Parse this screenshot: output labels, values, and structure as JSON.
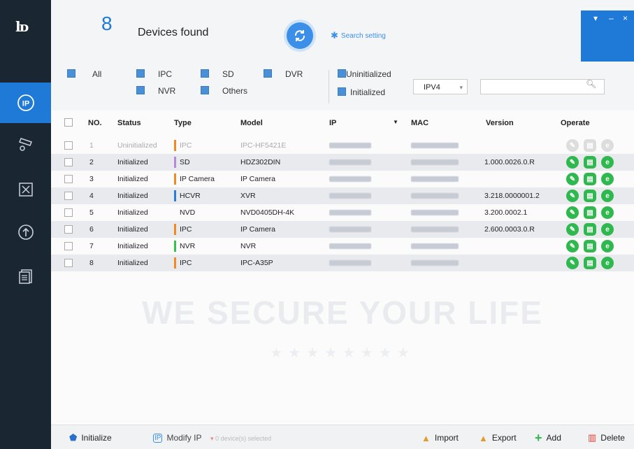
{
  "app": {
    "device_count": "8",
    "devices_found_label": "Devices found",
    "search_setting_label": "Search setting"
  },
  "filters": {
    "all": "All",
    "ipc": "IPC",
    "sd": "SD",
    "dvr": "DVR",
    "nvr": "NVR",
    "others": "Others",
    "uninitialized": "Uninitialized",
    "initialized": "Initialized",
    "ip_version": "IPV4",
    "search_placeholder": ""
  },
  "table": {
    "columns": [
      "NO.",
      "Status",
      "Type",
      "Model",
      "IP",
      "MAC",
      "Version",
      "Operate"
    ],
    "rows": [
      {
        "no": "1",
        "status": "Uninitialized",
        "type": "IPC",
        "model": "IPC-HF5421E",
        "version": "",
        "type_color": "#f08a24",
        "enabled": false
      },
      {
        "no": "2",
        "status": "Initialized",
        "type": "SD",
        "model": "HDZ302DIN",
        "version": "1.000.0026.0.R",
        "type_color": "#b58bd6",
        "enabled": true
      },
      {
        "no": "3",
        "status": "Initialized",
        "type": "IP Camera",
        "model": "IP Camera",
        "version": "",
        "type_color": "#f08a24",
        "enabled": true
      },
      {
        "no": "4",
        "status": "Initialized",
        "type": "HCVR",
        "model": "XVR",
        "version": "3.218.0000001.2",
        "type_color": "#2a7fd6",
        "enabled": true
      },
      {
        "no": "5",
        "status": "Initialized",
        "type": "NVD",
        "model": "NVD0405DH-4K",
        "version": "3.200.0002.1",
        "type_color": "",
        "enabled": true
      },
      {
        "no": "6",
        "status": "Initialized",
        "type": "IPC",
        "model": "IP Camera",
        "version": "2.600.0003.0.R",
        "type_color": "#f08a24",
        "enabled": true
      },
      {
        "no": "7",
        "status": "Initialized",
        "type": "NVR",
        "model": "NVR",
        "version": "",
        "type_color": "#34c24c",
        "enabled": true
      },
      {
        "no": "8",
        "status": "Initialized",
        "type": "IPC",
        "model": "IPC-A35P",
        "version": "",
        "type_color": "#f08a24",
        "enabled": true
      }
    ]
  },
  "watermark": "WE SECURE YOUR LIFE",
  "footer": {
    "initialize": "Initialize",
    "modify_ip": "Modify IP",
    "selected_count": "0",
    "selected_label": "device(s) selected",
    "import": "Import",
    "export": "Export",
    "add": "Add",
    "delete": "Delete"
  },
  "colors": {
    "accent": "#1e7ad6",
    "sidebar": "#1b2633",
    "operate_green": "#2fb84e"
  }
}
